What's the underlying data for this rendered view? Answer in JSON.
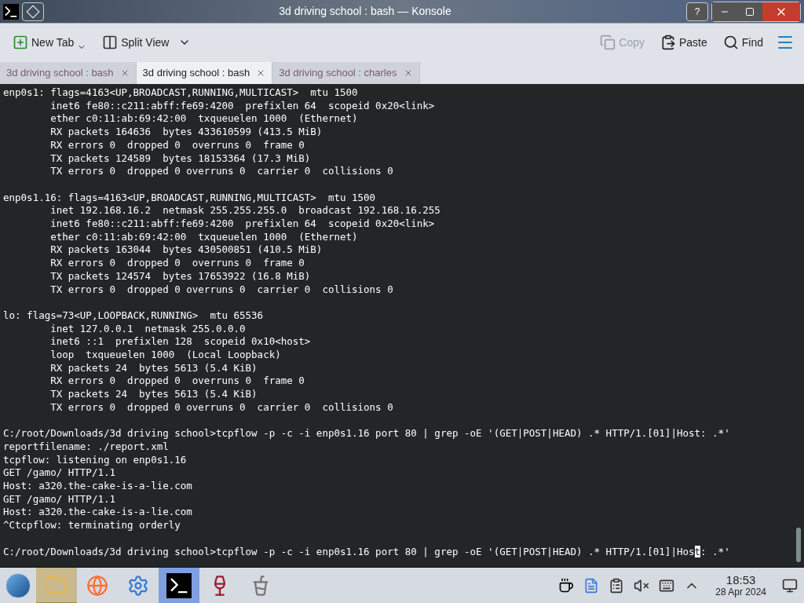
{
  "window": {
    "title": "3d driving school : bash — Konsole",
    "help": "?"
  },
  "toolbar": {
    "left": [
      {
        "label": "New Tab",
        "kind": "newtab"
      },
      {
        "label": "Split View",
        "kind": "split"
      }
    ],
    "right": [
      {
        "label": "Copy",
        "kind": "copy",
        "disabled": true
      },
      {
        "label": "Paste",
        "kind": "paste",
        "disabled": false
      },
      {
        "label": "Find",
        "kind": "find",
        "disabled": false
      }
    ]
  },
  "tabs": [
    {
      "label": "3d driving school : bash",
      "selected": false
    },
    {
      "label": "3d driving school : bash",
      "selected": true
    },
    {
      "label": "3d driving school : charles",
      "selected": false
    }
  ],
  "terminal": {
    "blocks": [
      [
        "enp0s1: flags=4163<UP,BROADCAST,RUNNING,MULTICAST>  mtu 1500",
        "        inet6 fe80::c211:abff:fe69:4200  prefixlen 64  scopeid 0x20<link>",
        "        ether c0:11:ab:69:42:00  txqueuelen 1000  (Ethernet)",
        "        RX packets 164636  bytes 433610599 (413.5 MiB)",
        "        RX errors 0  dropped 0  overruns 0  frame 0",
        "        TX packets 124589  bytes 18153364 (17.3 MiB)",
        "        TX errors 0  dropped 0 overruns 0  carrier 0  collisions 0"
      ],
      [
        "enp0s1.16: flags=4163<UP,BROADCAST,RUNNING,MULTICAST>  mtu 1500",
        "        inet 192.168.16.2  netmask 255.255.255.0  broadcast 192.168.16.255",
        "        inet6 fe80::c211:abff:fe69:4200  prefixlen 64  scopeid 0x20<link>",
        "        ether c0:11:ab:69:42:00  txqueuelen 1000  (Ethernet)",
        "        RX packets 163044  bytes 430500851 (410.5 MiB)",
        "        RX errors 0  dropped 0  overruns 0  frame 0",
        "        TX packets 124574  bytes 17653922 (16.8 MiB)",
        "        TX errors 0  dropped 0 overruns 0  carrier 0  collisions 0"
      ],
      [
        "lo: flags=73<UP,LOOPBACK,RUNNING>  mtu 65536",
        "        inet 127.0.0.1  netmask 255.0.0.0",
        "        inet6 ::1  prefixlen 128  scopeid 0x10<host>",
        "        loop  txqueuelen 1000  (Local Loopback)",
        "        RX packets 24  bytes 5613 (5.4 KiB)",
        "        RX errors 0  dropped 0  overruns 0  frame 0",
        "        TX packets 24  bytes 5613 (5.4 KiB)",
        "        TX errors 0  dropped 0 overruns 0  carrier 0  collisions 0"
      ],
      [
        "C:/root/Downloads/3d driving school>tcpflow -p -c -i enp0s1.16 port 80 | grep -oE '(GET|POST|HEAD) .* HTTP/1.[01]|Host: .*'",
        "reportfilename: ./report.xml",
        "tcpflow: listening on enp0s1.16",
        "GET /gamo/ HTTP/1.1",
        "Host: a320.the-cake-is-a-lie.com",
        "GET /gamo/ HTTP/1.1",
        "Host: a320.the-cake-is-a-lie.com",
        "^Ctcpflow: terminating orderly"
      ]
    ],
    "prompt": {
      "before": "C:/root/Downloads/3d driving school>tcpflow -p -c -i enp0s1.16 port 80 | grep -oE '(GET|POST|HEAD) .* HTTP/1.[01]|Hos",
      "cursor": "t",
      "after": ": .*'"
    }
  },
  "taskbar": {
    "apps": [
      {
        "kind": "folder",
        "selected": false,
        "highlighted": true
      },
      {
        "kind": "browser",
        "selected": false,
        "highlighted": false
      },
      {
        "kind": "settings",
        "selected": false,
        "highlighted": false
      },
      {
        "kind": "terminal",
        "selected": true,
        "highlighted": false
      },
      {
        "kind": "wine",
        "selected": false,
        "highlighted": false
      },
      {
        "kind": "jug",
        "selected": false,
        "highlighted": false
      }
    ],
    "clock": {
      "time": "18:53",
      "date": "28 Apr 2024"
    }
  }
}
